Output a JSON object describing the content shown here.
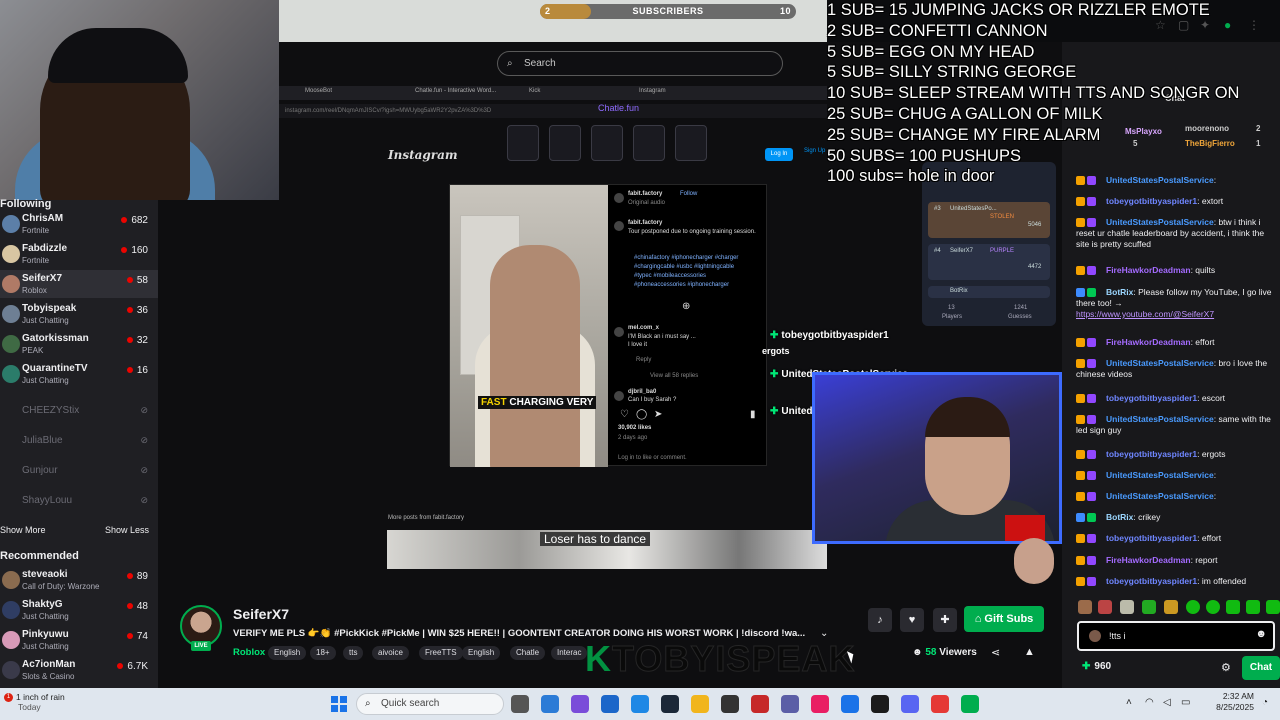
{
  "subscriber_bar": {
    "left": "2",
    "label": "SUBSCRIBERS",
    "right": "10",
    "progress": 0.2
  },
  "sub_goals": [
    "1 SUB= 15 JUMPING JACKS OR RIZZLER EMOTE",
    "2 SUB= CONFETTI CANNON",
    "5 SUB= EGG ON MY HEAD",
    "5 SUB= SILLY STRING GEORGE",
    "10 SUB= SLEEP STREAM WITH TTS AND SONGR ON",
    "25 SUB= CHUG A GALLON OF MILK",
    "25 SUB= CHANGE MY FIRE ALARM",
    "50 SUBS= 100 PUSHUPS",
    "100 subs= hole in door"
  ],
  "stream_browser": {
    "search_placeholder": "Search",
    "tabs": [
      "MooseBot",
      "Chatle.fun - Interactive Word...",
      "Kick",
      "Instagram"
    ],
    "url": "instagram.com/reel/DNqmAmJISCv/?igsh=MWUybg5aWR2Y2pvZA%3D%3D",
    "chatle_title": "Chatle.fun",
    "instagram_logo": "Instagram",
    "login": "Log In",
    "signup": "Sign Up",
    "post": {
      "account": "fabit.factory",
      "follow": "Follow",
      "audio": "Original audio",
      "caption": "Tour postponed due to ongoing training session.",
      "hashtags": [
        "#chinafactory #iphonecharger #charger",
        "#chargingcable #usbc #lightningcable",
        "#typec #mobileaccessories",
        "#phoneaccessories #iphonecharger"
      ],
      "video_caption_a": "FAST ",
      "video_caption_b": "CHARGING VERY",
      "comment1_user": "mel.com_x",
      "comment1_text": "I'M Black an i must say ...",
      "comment1_text2": "I love it",
      "reply": "Reply",
      "view_replies": "View all 58 replies",
      "comment2_user": "djbril_ba0",
      "comment2_text": "Can I buy Sarah ?",
      "likes": "30,902 likes",
      "ago": "2 days ago",
      "login_prompt": "Log in to like or comment."
    },
    "more_posts": "More posts from fabit.factory",
    "loser_text": "Loser has to dance",
    "leaderboard": {
      "rows": [
        {
          "rank": "#3",
          "name": "UnitedStatesPo...",
          "status": "STOLEN",
          "score": "5046"
        },
        {
          "rank": "#4",
          "name": "SeiferX7",
          "status": "PURPLE",
          "score": "4472"
        },
        {
          "rank": "",
          "name": "BotRix",
          "status": "",
          "score": ""
        }
      ],
      "players": "13",
      "players_label": "Players",
      "guesses": "1241",
      "guesses_label": "Guesses"
    }
  },
  "overlays": {
    "name1": "tobeygotbitbyaspider1",
    "word1": "ergots",
    "name2": "UnitedStatesPostalService",
    "name3": "UnitedStatesPostalService"
  },
  "sidebar": {
    "following_label": "Following",
    "following": [
      {
        "name": "ChrisAM",
        "game": "Fortnite",
        "viewers": "682",
        "color": "#5c7fa8"
      },
      {
        "name": "Fabdizzle",
        "game": "Fortnite",
        "viewers": "160",
        "color": "#d8c6a2"
      },
      {
        "name": "SeiferX7",
        "game": "Roblox",
        "viewers": "58",
        "color": "#b07a66"
      },
      {
        "name": "Tobyispeak",
        "game": "Just Chatting",
        "viewers": "36",
        "color": "#6e7f94"
      },
      {
        "name": "Gatorkissman",
        "game": "PEAK",
        "viewers": "32",
        "color": "#3f6a44"
      },
      {
        "name": "QuarantineTV",
        "game": "Just Chatting",
        "viewers": "16",
        "color": "#2b7c6a"
      }
    ],
    "offline": [
      "CHEEZYStix",
      "JuliaBlue",
      "Gunjour",
      "ShayyLouu"
    ],
    "show_more": "Show More",
    "show_less": "Show Less",
    "recommended_label": "Recommended",
    "recommended": [
      {
        "name": "steveaoki",
        "game": "Call of Duty: Warzone",
        "viewers": "89",
        "color": "#8a6b4f"
      },
      {
        "name": "ShaktyG",
        "game": "Just Chatting",
        "viewers": "48",
        "color": "#2f3d63"
      },
      {
        "name": "Pinkyuwu",
        "game": "Just Chatting",
        "viewers": "74",
        "color": "#d89ab8"
      },
      {
        "name": "Ac7ionMan",
        "game": "Slots & Casino",
        "viewers": "6.7K",
        "color": "#3a3a4a"
      }
    ]
  },
  "chat": {
    "title": "Chat",
    "top": [
      {
        "name": "MsPlayxo",
        "count": "5"
      },
      {
        "name": "moorenono",
        "count": "2"
      },
      {
        "name": "TheBigFierro",
        "count": "1"
      }
    ],
    "messages": [
      {
        "user": "UnitedStatesPostalService",
        "text": "",
        "cls": "usps"
      },
      {
        "user": "tobeygotbitbyaspider1",
        "text": "extort",
        "cls": "toby"
      },
      {
        "user": "UnitedStatesPostalService",
        "text": "btw i think i reset ur chatle leaderboard by accident, i think the site is pretty scuffed",
        "cls": "usps"
      },
      {
        "user": "FireHawkorDeadman",
        "text": "quilts",
        "cls": "fire"
      },
      {
        "user": "BotRix",
        "text": "Please follow my YouTube, I go live there too! →",
        "link": "https://www.youtube.com/@SeiferX7",
        "cls": "bot"
      },
      {
        "user": "FireHawkorDeadman",
        "text": "effort",
        "cls": "fire"
      },
      {
        "user": "UnitedStatesPostalService",
        "text": "bro i love the chinese videos",
        "cls": "usps"
      },
      {
        "user": "tobeygotbitbyaspider1",
        "text": "escort",
        "cls": "toby"
      },
      {
        "user": "UnitedStatesPostalService",
        "text": "same with the led sign guy",
        "cls": "usps"
      },
      {
        "user": "tobeygotbitbyaspider1",
        "text": "ergots",
        "cls": "toby"
      },
      {
        "user": "UnitedStatesPostalService",
        "text": "",
        "cls": "usps"
      },
      {
        "user": "UnitedStatesPostalService",
        "text": "",
        "cls": "usps"
      },
      {
        "user": "BotRix",
        "text": "crikey",
        "cls": "bot"
      },
      {
        "user": "tobeygotbitbyaspider1",
        "text": "effort",
        "cls": "toby"
      },
      {
        "user": "FireHawkorDeadman",
        "text": "report",
        "cls": "fire"
      },
      {
        "user": "tobeygotbitbyaspider1",
        "text": "im offended",
        "cls": "toby"
      }
    ],
    "input_value": "!tts i",
    "points": "960",
    "send": "Chat"
  },
  "channel": {
    "name": "SeiferX7",
    "live": "LIVE",
    "title": "VERIFY ME PLS 👉👏 #PickKick #PickMe | WIN $25 HERE!! | GOONTENT CREATOR DOING HIS WORST WORK | !discord !wa...",
    "game": "Roblox",
    "tags": [
      "English",
      "18+",
      "tts",
      "aivoice",
      "FreeTTS",
      "English",
      "Chatle",
      "Interac"
    ],
    "overlay_logo": "TOBYISPEAK",
    "gift": "Gift Subs",
    "viewers_count": "58",
    "viewers_label": "Viewers"
  },
  "taskbar": {
    "weather_badge": "1",
    "weather": "1 inch of rain",
    "weather_day": "Today",
    "search": "Quick search",
    "time": "2:32 AM",
    "date": "8/25/2025"
  }
}
